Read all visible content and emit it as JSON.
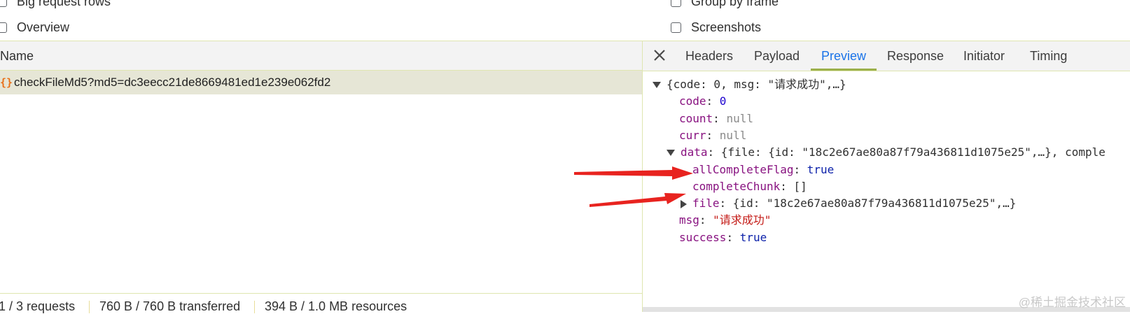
{
  "options": {
    "big_request_rows": "Big request rows",
    "group_by_frame": "Group by frame",
    "overview": "Overview",
    "screenshots": "Screenshots"
  },
  "request_list": {
    "header": "Name",
    "rows": [
      {
        "icon": "fetch-icon",
        "name": "checkFileMd5?md5=dc3eecc21de8669481ed1e239e062fd2"
      }
    ]
  },
  "status_bar": {
    "requests": "1 / 3 requests",
    "transferred": "760 B / 760 B transferred",
    "resources": "394 B / 1.0 MB resources"
  },
  "detail_tabs": {
    "close_icon": "close-icon",
    "items": [
      {
        "label": "Headers",
        "active": false
      },
      {
        "label": "Payload",
        "active": false
      },
      {
        "label": "Preview",
        "active": true
      },
      {
        "label": "Response",
        "active": false
      },
      {
        "label": "Initiator",
        "active": false
      },
      {
        "label": "Timing",
        "active": false
      }
    ]
  },
  "preview": {
    "root_summary": "{code: 0, msg: \"请求成功\",…}",
    "code": {
      "key": "code",
      "value": "0"
    },
    "count": {
      "key": "count",
      "value": "null"
    },
    "curr": {
      "key": "curr",
      "value": "null"
    },
    "data": {
      "key": "data",
      "summary": "{file: {id: \"18c2e67ae80a87f79a436811d1075e25\",…}, comple",
      "allCompleteFlag": {
        "key": "allCompleteFlag",
        "value": "true"
      },
      "completeChunk": {
        "key": "completeChunk",
        "value": "[]"
      },
      "file": {
        "key": "file",
        "summary": "{id: \"18c2e67ae80a87f79a436811d1075e25\",…}"
      }
    },
    "msg": {
      "key": "msg",
      "value": "\"请求成功\""
    },
    "success": {
      "key": "success",
      "value": "true"
    }
  },
  "annotations": {
    "arrow_color": "#e8231f"
  },
  "watermark": "@稀土掘金技术社区",
  "colors": {
    "accent": "#1a73e8",
    "tab_underline": "#9cb04a",
    "selected_row": "#e6e6d6"
  }
}
